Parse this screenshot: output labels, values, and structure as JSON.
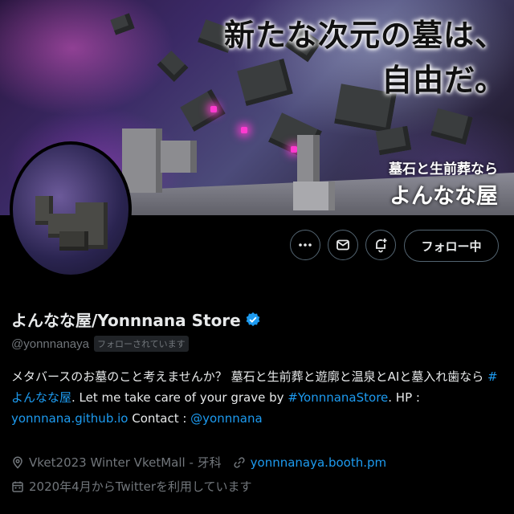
{
  "banner": {
    "headline": "新たな次元の墓は、\n自由だ。",
    "subline1": "墓石と生前葬なら",
    "subline2": "よんなな屋"
  },
  "actions": {
    "more_icon": "more-icon",
    "message_icon": "mail-icon",
    "notify_icon": "bell-plus-icon",
    "follow_label": "フォロー中"
  },
  "profile": {
    "display_name": "よんなな屋/Yonnnana Store",
    "handle": "@yonnnanaya",
    "follows_you": "フォローされています",
    "verified_color": "#1d9bf0"
  },
  "bio": {
    "text1": "メタバースのお墓のこと考えませんか？ 墓石と生前葬と遊廓と温泉とAIと墓入れ歯なら ",
    "hashtag1": "#よんなな屋",
    "text2": ". Let me take care of your grave by ",
    "hashtag2": "#YonnnanaStore",
    "text3": ". HP : ",
    "hp_link": "yonnnana.github.io",
    "text4": " Contact : ",
    "contact_link": "@yonnnana"
  },
  "meta": {
    "location": "Vket2023 Winter VketMall - 牙科",
    "website": "yonnnanaya.booth.pm",
    "joined": "2020年4月からTwitterを利用しています"
  }
}
